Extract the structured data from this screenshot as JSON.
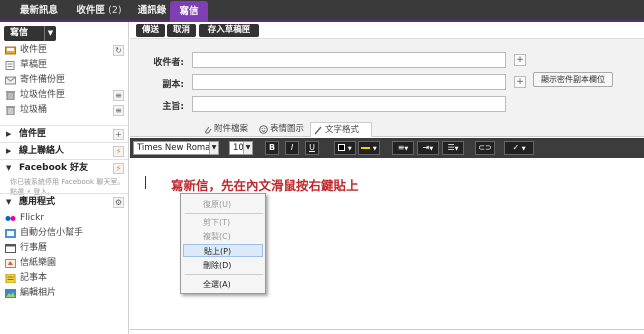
{
  "top_tabs": [
    {
      "label": "最新訊息",
      "count": ""
    },
    {
      "label": "收件匣",
      "count": "(2)"
    },
    {
      "label": "通訊錄",
      "count": ""
    },
    {
      "label": "寫信",
      "count": ""
    }
  ],
  "sidebar": {
    "compose_label": "寫信",
    "folders": [
      {
        "label": "收件匣",
        "icon": "inbox-icon",
        "action": "↻"
      },
      {
        "label": "草稿匣",
        "icon": "drafts-icon",
        "action": ""
      },
      {
        "label": "寄件備份匣",
        "icon": "sent-icon",
        "action": ""
      },
      {
        "label": "垃圾信件匣",
        "icon": "spam-icon",
        "action": "≡"
      },
      {
        "label": "垃圾桶",
        "icon": "trash-icon",
        "action": "≡"
      }
    ],
    "sections": [
      {
        "label": "信件匣",
        "action": "+"
      },
      {
        "label": "線上聯絡人",
        "action": "⚡"
      },
      {
        "label": "Facebook 好友",
        "action": "⚡"
      },
      {
        "label": "應用程式",
        "action": "⚙"
      }
    ],
    "facebook_hint": "你已被系統停用 Facebook 聊天室。點選 ⚡ 登入。",
    "apps": [
      {
        "label": "Flickr",
        "icon": "flickr-icon"
      },
      {
        "label": "自動分信小幫手",
        "icon": "mail-helper-icon"
      },
      {
        "label": "行事曆",
        "icon": "calendar-icon"
      },
      {
        "label": "信紙樂園",
        "icon": "stationery-icon"
      },
      {
        "label": "記事本",
        "icon": "notepad-icon"
      },
      {
        "label": "編輯相片",
        "icon": "photo-edit-icon"
      }
    ]
  },
  "toolbar": {
    "send": "傳送",
    "cancel": "取消",
    "save_draft": "存入草稿匣"
  },
  "form": {
    "to_label": "收件者:",
    "cc_label": "副本:",
    "subject_label": "主旨:",
    "show_bcc": "顯示密件副本欄位"
  },
  "editor_tabs": [
    "附件檔案",
    "表情圖示",
    "文字格式"
  ],
  "format": {
    "font": "Times New Roman",
    "size": "10",
    "bold": "B",
    "italic": "I",
    "underline": "U"
  },
  "editor": {
    "text": "寫新信，先在內文滑鼠按右鍵貼上"
  },
  "context_menu": [
    {
      "label": "復原(U)",
      "enabled": false
    },
    {
      "label": "剪下(T)",
      "enabled": false
    },
    {
      "label": "複製(C)",
      "enabled": false
    },
    {
      "label": "貼上(P)",
      "enabled": true,
      "highlight": true
    },
    {
      "label": "刪除(D)",
      "enabled": true
    },
    {
      "label": "全選(A)",
      "enabled": true
    }
  ],
  "colors": {
    "accent": "#7e3fb5",
    "dark": "#3a3a3a",
    "editor_text": "#c0282d"
  }
}
